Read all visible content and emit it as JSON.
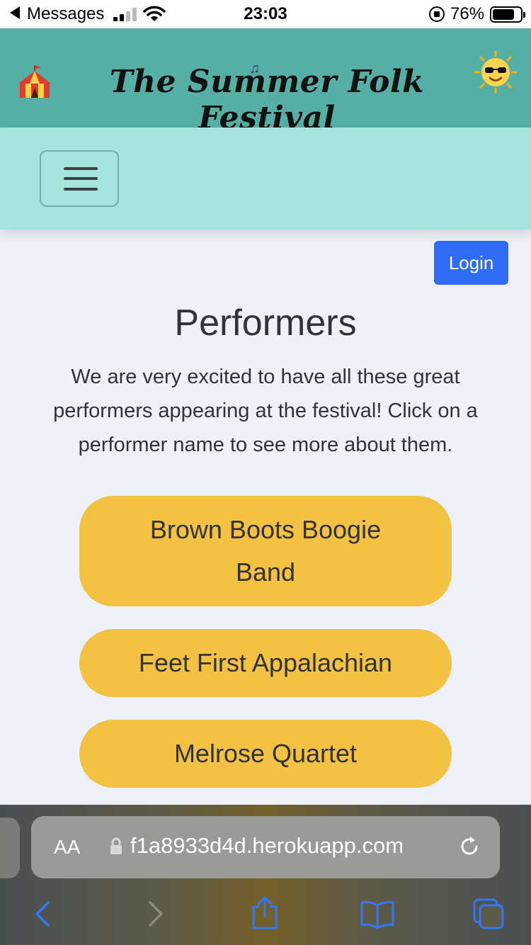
{
  "status_bar": {
    "back_app": "Messages",
    "time": "23:03",
    "battery_pct": "76%"
  },
  "header": {
    "title": "The Summer Folk Festival",
    "left_icon": "circus-tent-icon",
    "music_icon": "music-notes-icon",
    "right_icon": "sun-with-sunglasses-icon"
  },
  "nav": {
    "menu_icon": "hamburger-menu-icon"
  },
  "auth": {
    "login_label": "Login"
  },
  "main": {
    "title": "Performers",
    "intro": "We are very excited to have all these great performers appearing at the festival! Click on a performer name to see more about them.",
    "performers": [
      "Brown Boots Boogie Band",
      "Feet First Appalachian",
      "Melrose Quartet"
    ]
  },
  "browser": {
    "text_size_label": "AA",
    "url": "f1a8933d4d.herokuapp.com",
    "toolbar": [
      "back-icon",
      "forward-icon",
      "share-icon",
      "bookmarks-icon",
      "tabs-icon"
    ]
  },
  "colors": {
    "header_bg": "#55afa4",
    "nav_bg": "#a6e3dc",
    "page_bg": "#eef2f8",
    "login_bg": "#2f6cf6",
    "performer_bg": "#f4c242",
    "ios_link": "#3478f6"
  }
}
